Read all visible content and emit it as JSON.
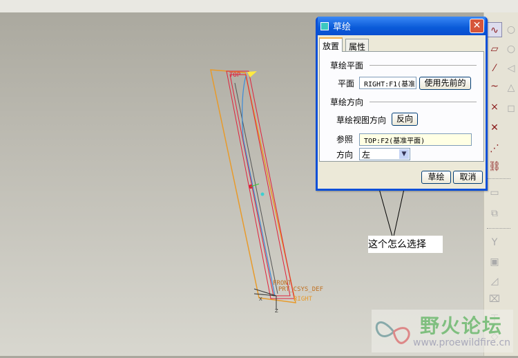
{
  "dialog": {
    "title": "草绘",
    "close_icon": "close-icon",
    "tabs": [
      {
        "label": "放置",
        "active": true
      },
      {
        "label": "属性",
        "active": false
      }
    ],
    "sketch_plane": {
      "section": "草绘平面",
      "plane_label": "平面",
      "plane_value": "RIGHT:F1(基准",
      "use_previous": "使用先前的"
    },
    "sketch_orientation": {
      "section": "草绘方向",
      "view_dir_label": "草绘视图方向",
      "flip": "反向",
      "reference_label": "参照",
      "reference_value": "TOP:F2(基准平面)",
      "orientation_label": "方向",
      "orientation_value": "左"
    },
    "ok": "草绘",
    "cancel": "取消"
  },
  "model": {
    "labels": [
      "TOP",
      "FRONT",
      "PRT_CSYS_DEF",
      "RIGHT",
      "X",
      "Z"
    ]
  },
  "annotation": "这个怎么选择",
  "watermark": {
    "title": "野火论坛",
    "url": "www.proewildfire.cn"
  },
  "colors": {
    "plane": "#e89a2a",
    "datum": "#e0203a",
    "curve": "#3a8ad8",
    "dialog_title": "#0a4fd8"
  }
}
